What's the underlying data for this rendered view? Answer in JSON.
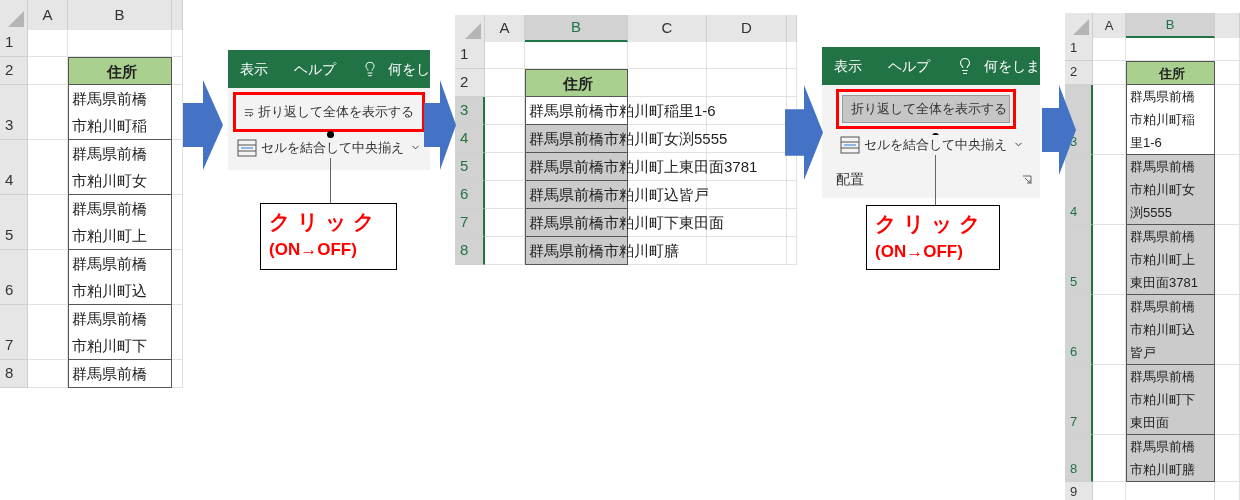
{
  "panels": [
    {
      "kind": "sheet",
      "columns": [
        {
          "label": "A",
          "selected": false
        },
        {
          "label": "B",
          "selected": false
        }
      ],
      "rows": [
        {
          "number": "1",
          "selected": false
        },
        {
          "number": "2",
          "selected": false,
          "cell": {
            "kind": "header",
            "lines": [
              "住所"
            ]
          }
        },
        {
          "number": "3",
          "selected": false,
          "cell": {
            "kind": "data",
            "lines": [
              "群馬県前橋",
              "市粕川町稲"
            ],
            "selected": false
          }
        },
        {
          "number": "4",
          "selected": false,
          "cell": {
            "kind": "data",
            "lines": [
              "群馬県前橋",
              "市粕川町女"
            ],
            "selected": false
          }
        },
        {
          "number": "5",
          "selected": false,
          "cell": {
            "kind": "data",
            "lines": [
              "群馬県前橋",
              "市粕川町上"
            ],
            "selected": false
          }
        },
        {
          "number": "6",
          "selected": false,
          "cell": {
            "kind": "data",
            "lines": [
              "群馬県前橋",
              "市粕川町込"
            ],
            "selected": false
          }
        },
        {
          "number": "7",
          "selected": false,
          "cell": {
            "kind": "data",
            "lines": [
              "群馬県前橋",
              "市粕川町下"
            ],
            "selected": false
          }
        },
        {
          "number": "8",
          "selected": false,
          "cell": {
            "kind": "data",
            "lines": [
              "群馬県前橋"
            ],
            "selected": false
          }
        }
      ]
    },
    {
      "kind": "arrow"
    },
    {
      "kind": "ribbon",
      "tabs": [
        {
          "label": "表示"
        },
        {
          "label": "ヘルプ"
        }
      ],
      "search": "何をし",
      "wrap_button": {
        "label": "折り返して全体を表示する",
        "pressed": false
      },
      "merge_button": {
        "label": "セルを結合して中央揃え"
      },
      "callout": {
        "title": "クリック",
        "note": "(ON→OFF)"
      }
    },
    {
      "kind": "arrow"
    },
    {
      "kind": "sheet",
      "columns": [
        {
          "label": "A",
          "selected": false
        },
        {
          "label": "B",
          "selected": true
        },
        {
          "label": "C",
          "selected": false
        },
        {
          "label": "D",
          "selected": false
        }
      ],
      "rows": [
        {
          "number": "1",
          "selected": false
        },
        {
          "number": "2",
          "selected": false,
          "cell": {
            "kind": "header",
            "lines": [
              "住所"
            ]
          }
        },
        {
          "number": "3",
          "selected": true,
          "cell": {
            "kind": "data",
            "lines": [
              "群馬県前橋市粕川町稲里1-6"
            ],
            "selected": false
          }
        },
        {
          "number": "4",
          "selected": true,
          "cell": {
            "kind": "data",
            "lines": [
              "群馬県前橋市粕川町女渕5555"
            ],
            "selected": true
          }
        },
        {
          "number": "5",
          "selected": true,
          "cell": {
            "kind": "data",
            "lines": [
              "群馬県前橋市粕川町上東田面3781"
            ],
            "selected": true
          }
        },
        {
          "number": "6",
          "selected": true,
          "cell": {
            "kind": "data",
            "lines": [
              "群馬県前橋市粕川町込皆戸"
            ],
            "selected": true
          }
        },
        {
          "number": "7",
          "selected": true,
          "cell": {
            "kind": "data",
            "lines": [
              "群馬県前橋市粕川町下東田面"
            ],
            "selected": true
          }
        },
        {
          "number": "8",
          "selected": true,
          "cell": {
            "kind": "data",
            "lines": [
              "群馬県前橋市粕川町膳"
            ],
            "selected": true
          }
        }
      ]
    },
    {
      "kind": "arrow"
    },
    {
      "kind": "ribbon",
      "tabs": [
        {
          "label": "表示"
        },
        {
          "label": "ヘルプ"
        }
      ],
      "search": "何をしま",
      "wrap_button": {
        "label": "折り返して全体を表示する",
        "pressed": true
      },
      "merge_button": {
        "label": "セルを結合して中央揃え"
      },
      "group_label": "配置",
      "callout": {
        "title": "クリック",
        "note": "(ON→OFF)"
      }
    },
    {
      "kind": "arrow"
    },
    {
      "kind": "sheet",
      "columns": [
        {
          "label": "A",
          "selected": false
        },
        {
          "label": "B",
          "selected": true
        }
      ],
      "rows": [
        {
          "number": "1",
          "selected": false
        },
        {
          "number": "2",
          "selected": false,
          "cell": {
            "kind": "header",
            "lines": [
              "住所"
            ]
          }
        },
        {
          "number": "3",
          "selected": true,
          "cell": {
            "kind": "data",
            "lines": [
              "群馬県前橋",
              "市粕川町稲",
              "里1-6"
            ],
            "selected": false
          }
        },
        {
          "number": "4",
          "selected": true,
          "cell": {
            "kind": "data",
            "lines": [
              "群馬県前橋",
              "市粕川町女",
              "渕5555"
            ],
            "selected": true
          }
        },
        {
          "number": "5",
          "selected": true,
          "cell": {
            "kind": "data",
            "lines": [
              "群馬県前橋",
              "市粕川町上",
              "東田面3781"
            ],
            "selected": true
          }
        },
        {
          "number": "6",
          "selected": true,
          "cell": {
            "kind": "data",
            "lines": [
              "群馬県前橋",
              "市粕川町込",
              "皆戸"
            ],
            "selected": true
          }
        },
        {
          "number": "7",
          "selected": true,
          "cell": {
            "kind": "data",
            "lines": [
              "群馬県前橋",
              "市粕川町下",
              "東田面"
            ],
            "selected": true
          }
        },
        {
          "number": "8",
          "selected": true,
          "cell": {
            "kind": "data",
            "lines": [
              "群馬県前橋",
              "市粕川町膳"
            ],
            "selected": true
          }
        },
        {
          "number": "9",
          "selected": false
        }
      ]
    }
  ]
}
